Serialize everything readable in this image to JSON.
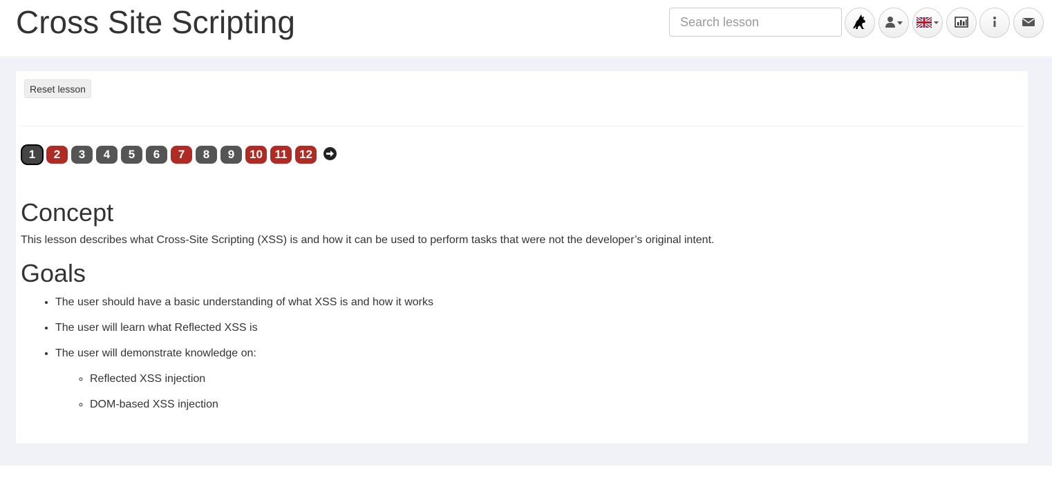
{
  "header": {
    "title": "Cross Site Scripting",
    "search_placeholder": "Search lesson",
    "icons": [
      "wolf-icon",
      "user-icon",
      "uk-flag-icon",
      "report-card-icon",
      "info-icon",
      "envelope-icon"
    ]
  },
  "lesson": {
    "reset_label": "Reset lesson",
    "pages": [
      {
        "label": "1",
        "status": "current"
      },
      {
        "label": "2",
        "status": "incomplete"
      },
      {
        "label": "3",
        "status": "content"
      },
      {
        "label": "4",
        "status": "content"
      },
      {
        "label": "5",
        "status": "content"
      },
      {
        "label": "6",
        "status": "content"
      },
      {
        "label": "7",
        "status": "incomplete"
      },
      {
        "label": "8",
        "status": "content"
      },
      {
        "label": "9",
        "status": "content"
      },
      {
        "label": "10",
        "status": "incomplete"
      },
      {
        "label": "11",
        "status": "incomplete"
      },
      {
        "label": "12",
        "status": "incomplete"
      }
    ],
    "next_icon": "arrow-right-circle-icon"
  },
  "content": {
    "concept_heading": "Concept",
    "concept_text": "This lesson describes what Cross-Site Scripting (XSS) is and how it can be used to perform tasks that were not the developer’s original intent.",
    "goals_heading": "Goals",
    "goals": [
      "The user should have a basic understanding of what XSS is and how it works",
      "The user will learn what Reflected XSS is",
      "The user will demonstrate knowledge on:"
    ],
    "sub_goals": [
      "Reflected XSS injection",
      "DOM-based XSS injection"
    ]
  },
  "colors": {
    "page_background": "#f0f2f7",
    "page_gray": "#555555",
    "page_red": "#b02b24",
    "text": "#333333"
  }
}
